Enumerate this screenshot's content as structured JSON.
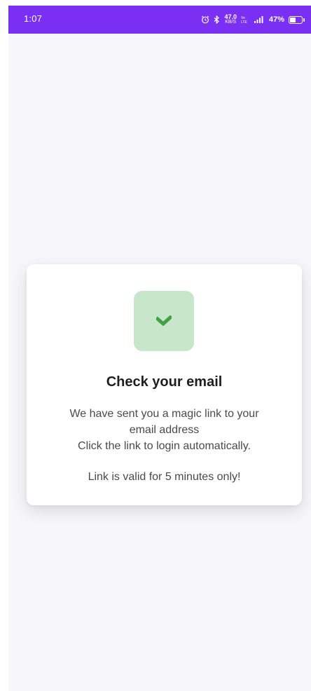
{
  "status_bar": {
    "time": "1:07",
    "net_speed_value": "47.0",
    "net_speed_unit": "KB/S",
    "battery_percent": "47%",
    "battery_level": 0.47,
    "icons": [
      "alarm-icon",
      "bluetooth-icon",
      "network-speed-indicator",
      "hd-volte-icon",
      "signal-icon",
      "battery-icon"
    ]
  },
  "colors": {
    "status_bar_bg": "#7b2ff2",
    "page_bg": "#f7f7fb",
    "success_tile_bg": "#c8e6c9",
    "success_check": "#43a047"
  },
  "card": {
    "icon": "check-icon",
    "title": "Check your email",
    "message_lines": [
      "We have sent you a magic link to your",
      "email address",
      "Click the link to login automatically."
    ],
    "validity_note": "Link is valid for 5 minutes only!"
  }
}
